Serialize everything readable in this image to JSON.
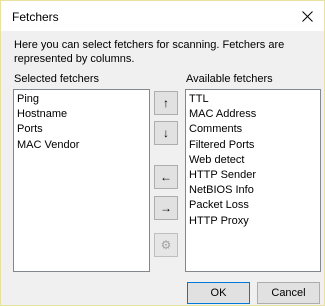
{
  "window": {
    "title": "Fetchers",
    "close_icon": "close-icon"
  },
  "description": "Here you can select fetchers for scanning. Fetchers are represented by columns.",
  "selected": {
    "label": "Selected fetchers",
    "items": [
      "Ping",
      "Hostname",
      "Ports",
      "MAC Vendor"
    ]
  },
  "available": {
    "label": "Available fetchers",
    "items": [
      "TTL",
      "MAC Address",
      "Comments",
      "Filtered Ports",
      "Web detect",
      "HTTP Sender",
      "NetBIOS Info",
      "Packet Loss",
      "HTTP Proxy"
    ]
  },
  "buttons": {
    "move_up": "↑",
    "move_down": "↓",
    "add": "←",
    "remove": "→",
    "options": "⚙",
    "ok": "OK",
    "cancel": "Cancel"
  }
}
